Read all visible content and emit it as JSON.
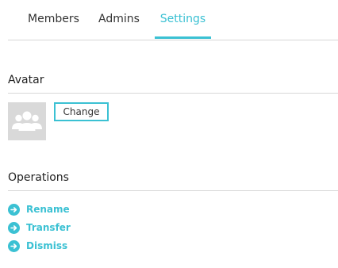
{
  "tabs": [
    {
      "label": "Members"
    },
    {
      "label": "Admins"
    },
    {
      "label": "Settings",
      "active": true
    }
  ],
  "avatar_section": {
    "title": "Avatar",
    "change_label": "Change"
  },
  "operations": {
    "title": "Operations",
    "items": [
      {
        "label": "Rename",
        "icon": "arrow-right-circle-icon"
      },
      {
        "label": "Transfer",
        "icon": "arrow-right-circle-icon"
      },
      {
        "label": "Dismiss",
        "icon": "arrow-right-circle-icon"
      }
    ]
  },
  "colors": {
    "accent": "#3bc1d3",
    "divider": "#d7d7d7",
    "avatar_bg": "#d9d9d9"
  }
}
